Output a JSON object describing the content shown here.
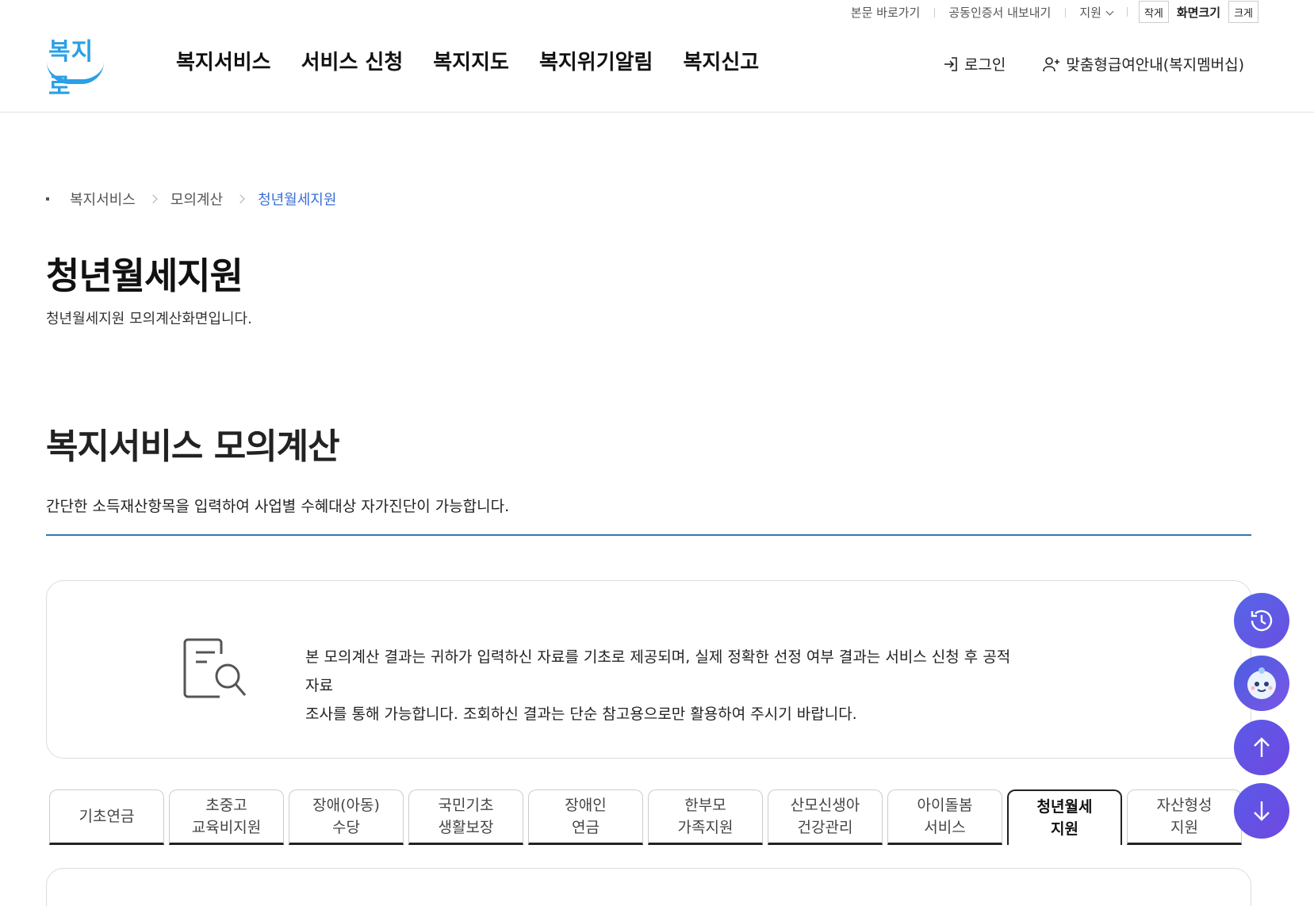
{
  "utility": {
    "skip_link": "본문 바로가기",
    "cert_export": "공동인증서 내보내기",
    "region": "지원",
    "font_small": "작게",
    "font_label": "화면크기",
    "font_large": "크게"
  },
  "header": {
    "logo_text": "복지로",
    "nav": [
      "복지서비스",
      "서비스 신청",
      "복지지도",
      "복지위기알림",
      "복지신고"
    ],
    "login": "로그인",
    "membership": "맞춤형급여안내(복지멤버십)"
  },
  "breadcrumb": {
    "items": [
      "복지서비스",
      "모의계산"
    ],
    "current": "청년월세지원"
  },
  "page": {
    "title": "청년월세지원",
    "subtitle": "청년월세지원 모의계산화면입니다."
  },
  "section": {
    "title": "복지서비스 모의계산",
    "description": "간단한 소득재산항목을 입력하여 사업별 수혜대상 자가진단이 가능합니다."
  },
  "notice": {
    "line1": "본 모의계산 결과는 귀하가 입력하신 자료를 기초로 제공되며, 실제 정확한 선정 여부 결과는 서비스 신청 후 공적자료",
    "line2": "조사를 통해 가능합니다. 조회하신 결과는 단순 참고용으로만 활용하여 주시기 바랍니다."
  },
  "tabs": [
    {
      "line1": "기초연금",
      "line2": ""
    },
    {
      "line1": "초중고",
      "line2": "교육비지원"
    },
    {
      "line1": "장애(아동)",
      "line2": "수당"
    },
    {
      "line1": "국민기초",
      "line2": "생활보장"
    },
    {
      "line1": "장애인",
      "line2": "연금"
    },
    {
      "line1": "한부모",
      "line2": "가족지원"
    },
    {
      "line1": "산모신생아",
      "line2": "건강관리"
    },
    {
      "line1": "아이돌봄",
      "line2": "서비스"
    },
    {
      "line1": "청년월세",
      "line2": "지원"
    },
    {
      "line1": "자산형성",
      "line2": "지원"
    }
  ],
  "active_tab": "청년월세 지원",
  "colors": {
    "brand": "#2aa0e6",
    "breadcrumb_current": "#3a6fd8",
    "section_line": "#2b7cb2",
    "fab": "#5a5ae8"
  }
}
